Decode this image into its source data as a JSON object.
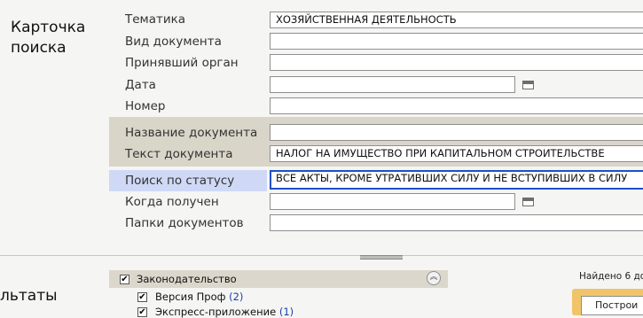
{
  "sidebar": {
    "title_line1": "Карточка",
    "title_line2": "поиска",
    "results_label": "льтаты"
  },
  "form": {
    "fields": [
      {
        "label": "Тематика",
        "value": "ХОЗЯЙСТВЕННАЯ ДЕЯТЕЛЬНОСТЬ"
      },
      {
        "label": "Вид документа",
        "value": ""
      },
      {
        "label": "Принявший орган",
        "value": ""
      },
      {
        "label": "Дата",
        "value": ""
      },
      {
        "label": "Номер",
        "value": ""
      },
      {
        "label": "Название документа",
        "value": ""
      },
      {
        "label": "Текст документа",
        "value": "НАЛОГ НА ИМУЩЕСТВО ПРИ КАПИТАЛЬНОМ СТРОИТЕЛЬСТВЕ"
      },
      {
        "label": "Поиск по статусу",
        "value": "ВСЕ АКТЫ, КРОМЕ УТРАТИВШИХ СИЛУ И НЕ ВСТУПИВШИХ В СИЛУ"
      },
      {
        "label": "Когда получен",
        "value": ""
      },
      {
        "label": "Папки документов",
        "value": ""
      }
    ]
  },
  "results": {
    "tree": {
      "header": "Законодательство",
      "items": [
        {
          "label": "Версия Проф",
          "count": "(2)"
        },
        {
          "label": "Экспресс-приложение",
          "count": "(1)"
        }
      ]
    },
    "found_text": "Найдено 6 до",
    "build_button": "Построи"
  },
  "colors": {
    "active_border": "#1e4fc8",
    "status_highlight": "#cfd9f6",
    "group_background": "#d9d5c9",
    "button_accent": "#f2c46a",
    "link": "#1c3fa8"
  },
  "icons": {
    "calendar": "calendar-icon",
    "collapse": "collapse-up-icon",
    "checkbox": "checkbox-checked-icon"
  }
}
